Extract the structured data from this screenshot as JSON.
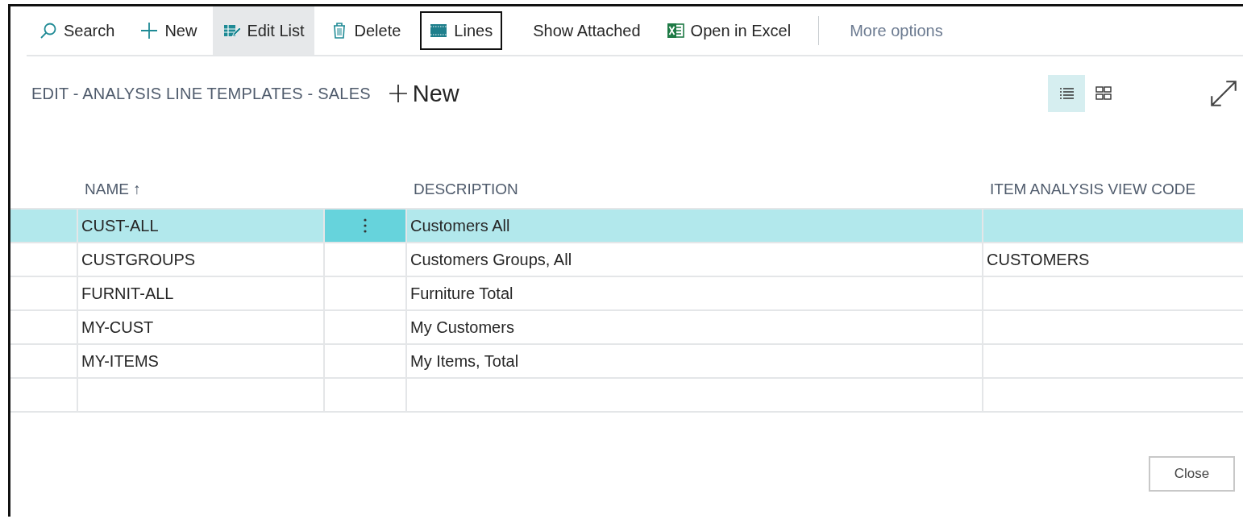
{
  "actions": [
    {
      "kind": "search",
      "label": "Search",
      "selected": false,
      "outlined": false
    },
    {
      "kind": "add",
      "label": "New",
      "selected": false,
      "outlined": false
    },
    {
      "kind": "edit",
      "label": "Edit List",
      "selected": true,
      "outlined": false
    },
    {
      "kind": "delete",
      "label": "Delete",
      "selected": false,
      "outlined": false
    },
    {
      "kind": "lines",
      "label": "Lines",
      "selected": false,
      "outlined": true
    },
    {
      "kind": "plain",
      "label": "Show Attached",
      "selected": false,
      "outlined": false
    },
    {
      "kind": "excel",
      "label": "Open in Excel",
      "selected": false,
      "outlined": false
    },
    {
      "kind": "more",
      "label": "More options",
      "selected": false,
      "outlined": false
    }
  ],
  "page": {
    "title": "EDIT - ANALYSIS LINE TEMPLATES - SALES",
    "new_label": "New"
  },
  "views": [
    {
      "kind": "list",
      "selected": true
    },
    {
      "kind": "tiles",
      "selected": false
    }
  ],
  "table": {
    "columns": [
      {
        "label": "NAME",
        "sort": "↑"
      },
      {
        "label": "DESCRIPTION"
      },
      {
        "label": "ITEM ANALYSIS VIEW CODE"
      }
    ],
    "rows": [
      {
        "name": "CUST-ALL",
        "description": "Customers All",
        "code": "",
        "selected": true
      },
      {
        "name": "CUSTGROUPS",
        "description": "Customers Groups, All",
        "code": "CUSTOMERS",
        "selected": false
      },
      {
        "name": "FURNIT-ALL",
        "description": "Furniture Total",
        "code": "",
        "selected": false
      },
      {
        "name": "MY-CUST",
        "description": "My Customers",
        "code": "",
        "selected": false
      },
      {
        "name": "MY-ITEMS",
        "description": "My Items, Total",
        "code": "",
        "selected": false
      }
    ]
  },
  "buttons": [
    {
      "label": "Close"
    }
  ]
}
